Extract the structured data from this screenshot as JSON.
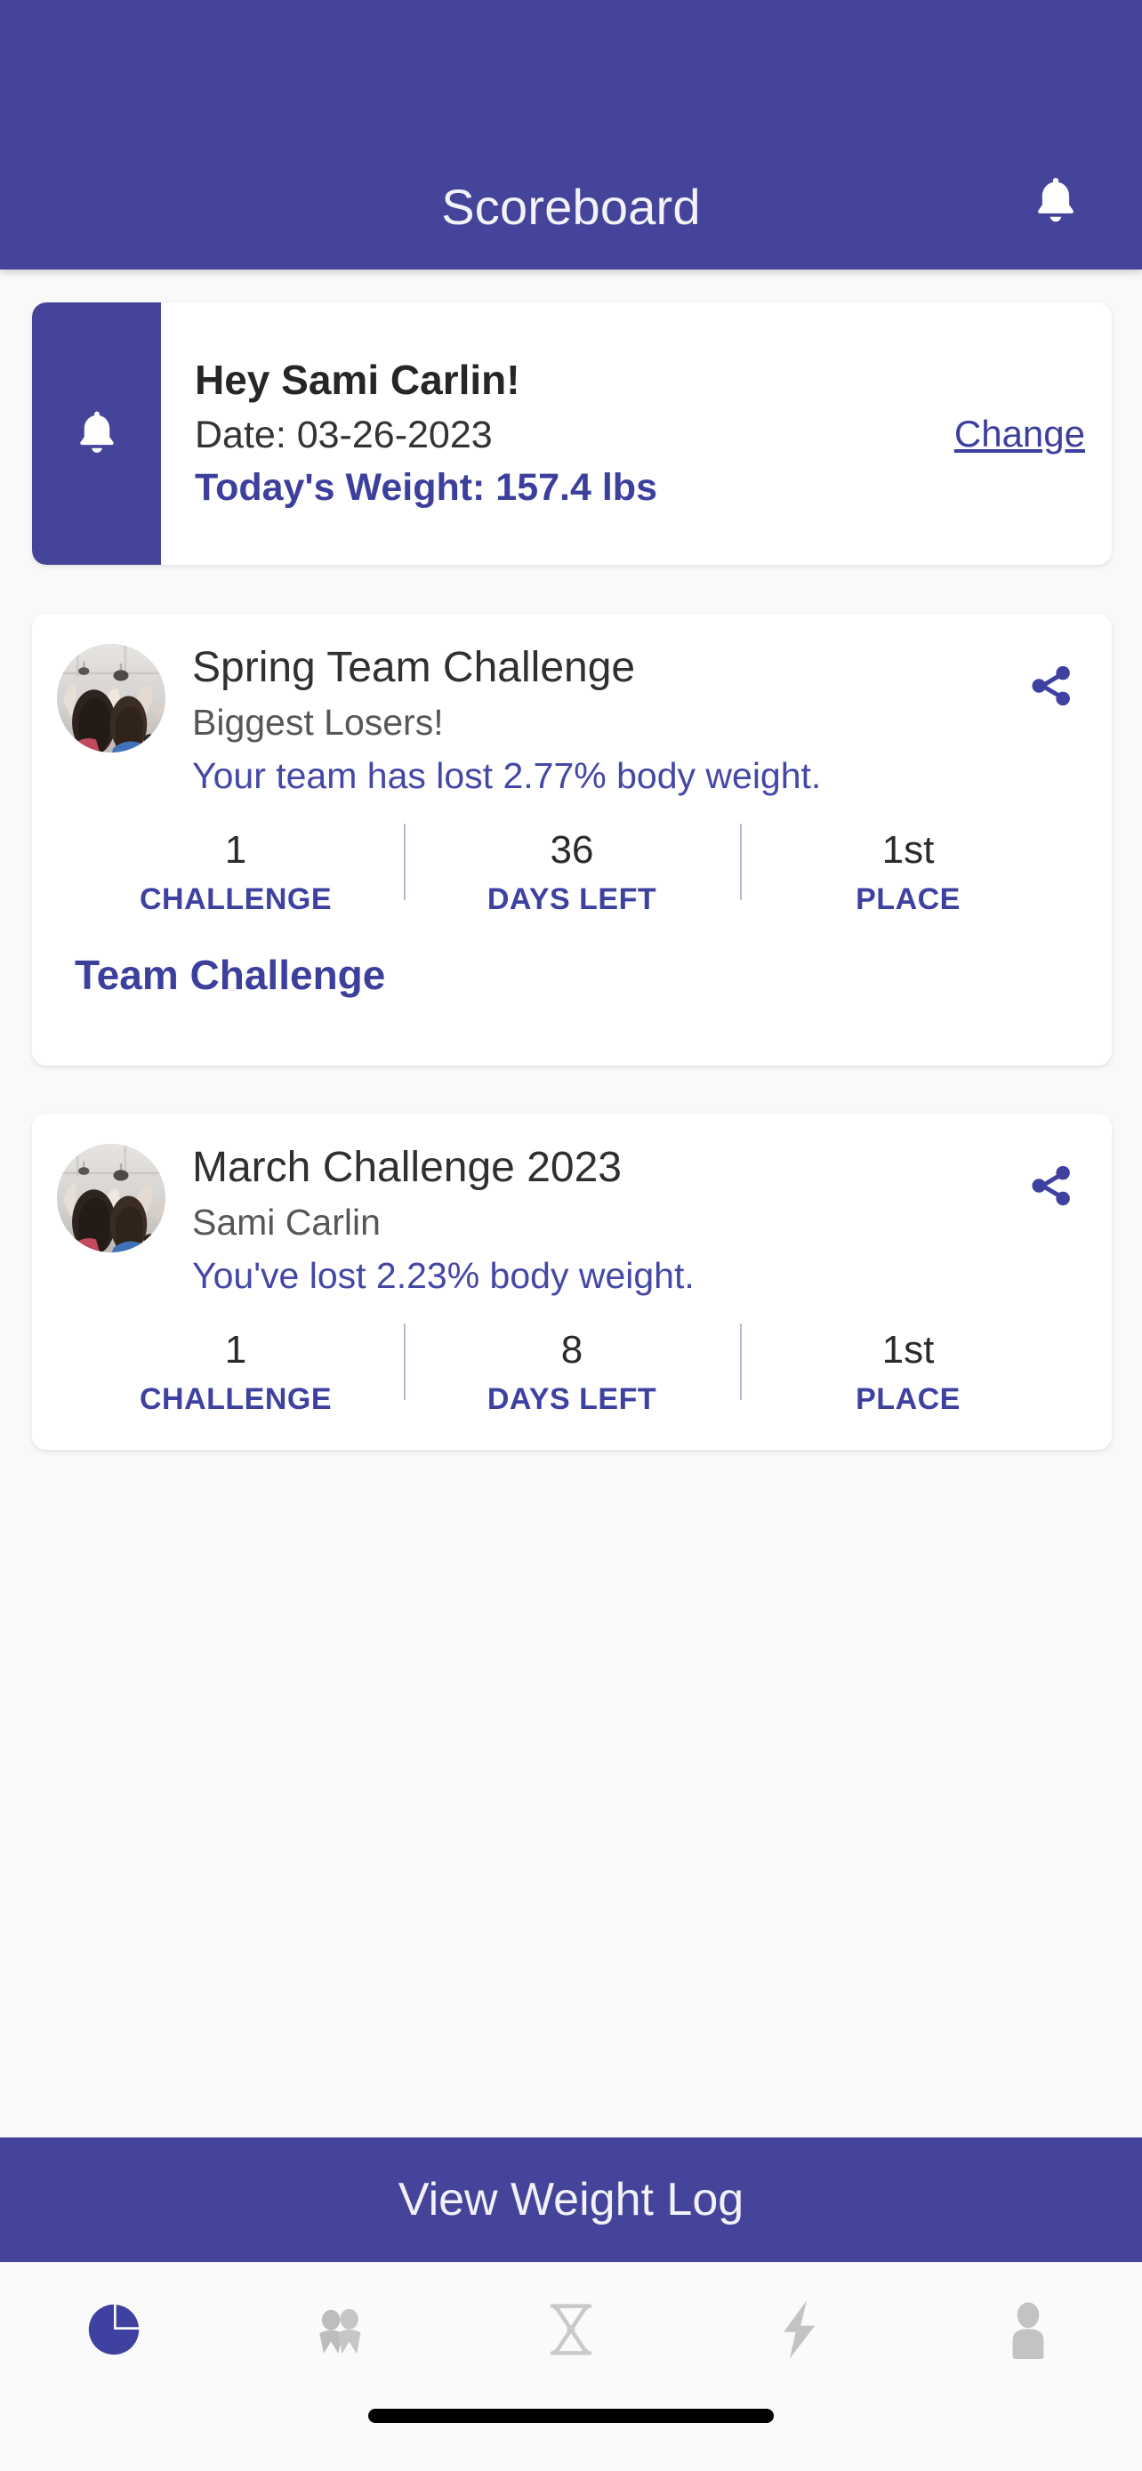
{
  "header": {
    "title": "Scoreboard",
    "bell_icon": "bell-icon",
    "background_color": "#44459a"
  },
  "greeting": {
    "accent_icon": "bell-icon",
    "name": "Hey Sami Carlin!",
    "date": "Date: 03-26-2023",
    "weight": "Today's Weight: 157.4 lbs",
    "change_label": "Change",
    "accent_color": "#44459a",
    "link_color": "#3c3f9c"
  },
  "challenges": [
    {
      "avatar_icon": "gym-group-photo",
      "title": "Spring Team Challenge",
      "subtitle": "Biggest Losers!",
      "progress_text": "Your team has lost 2.77% body weight.",
      "share_icon": "share-icon",
      "stats": [
        {
          "value": "1",
          "label": "CHALLENGE"
        },
        {
          "value": "36",
          "label": "DAYS LEFT"
        },
        {
          "value": "1st",
          "label": "PLACE"
        }
      ],
      "link_label": "Team Challenge"
    },
    {
      "avatar_icon": "gym-group-photo",
      "title": "March Challenge 2023",
      "subtitle": "Sami Carlin",
      "progress_text": "You've lost 2.23% body weight.",
      "share_icon": "share-icon",
      "stats": [
        {
          "value": "1",
          "label": "CHALLENGE"
        },
        {
          "value": "8",
          "label": "DAYS LEFT"
        },
        {
          "value": "1st",
          "label": "PLACE"
        }
      ],
      "link_label": ""
    }
  ],
  "cta": {
    "label": "View Weight Log",
    "background_color": "#44459a"
  },
  "tabbar": {
    "active_color": "#3f41a0",
    "inactive_color": "#bdbdbd",
    "items": [
      {
        "icon": "pie-chart-icon",
        "active": true
      },
      {
        "icon": "people-group-icon",
        "active": false
      },
      {
        "icon": "hourglass-icon",
        "active": false
      },
      {
        "icon": "lightning-bolt-icon",
        "active": false
      },
      {
        "icon": "person-icon",
        "active": false
      }
    ]
  }
}
